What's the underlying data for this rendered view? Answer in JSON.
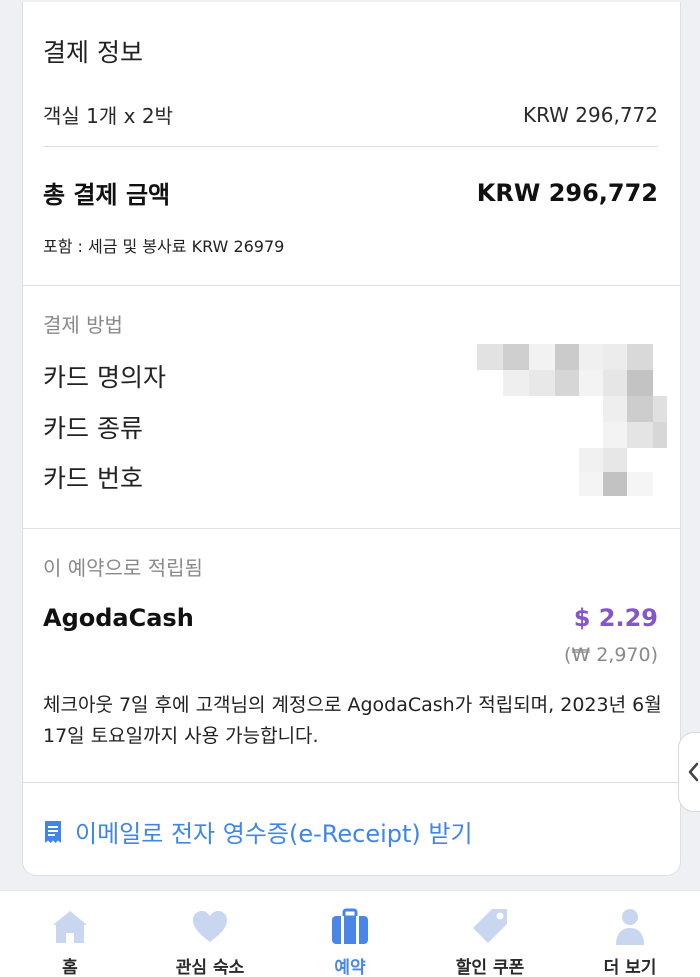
{
  "payment_info": {
    "title": "결제 정보",
    "room_line_label": "객실 1개 x 2박",
    "room_line_amount": "KRW 296,772",
    "total_label": "총 결제 금액",
    "total_amount": "KRW 296,772",
    "tax_note": "포함 : 세금 및 봉사료 KRW 26979"
  },
  "payment_method": {
    "header": "결제 방법",
    "cardholder_label": "카드 명의자",
    "card_type_label": "카드 종류",
    "card_number_label": "카드 번호"
  },
  "earnings": {
    "header": "이 예약으로 적립됨",
    "agodacash_label": "AgodaCash",
    "agodacash_amount": "$ 2.29",
    "agodacash_krw": "(₩ 2,970)",
    "note": "체크아웃 7일 후에 고객님의 계정으로 AgodaCash가 적립되며, 2023년 6월 17일 토요일까지 사용 가능합니다."
  },
  "receipt": {
    "label": "이메일로 전자 영수증(e-Receipt) 받기",
    "icon": "receipt-icon"
  },
  "bottom_nav": {
    "items": [
      {
        "label": "홈",
        "icon": "home-icon",
        "active": false
      },
      {
        "label": "관심 숙소",
        "icon": "heart-icon",
        "active": false
      },
      {
        "label": "예약",
        "icon": "suitcase-icon",
        "active": true
      },
      {
        "label": "할인 쿠폰",
        "icon": "tag-icon",
        "active": false
      },
      {
        "label": "더 보기",
        "icon": "person-icon",
        "active": false
      }
    ]
  },
  "colors": {
    "accent": "#4a86e8",
    "agodacash": "#8356c9",
    "inactive_icon": "#c9d6f0"
  }
}
